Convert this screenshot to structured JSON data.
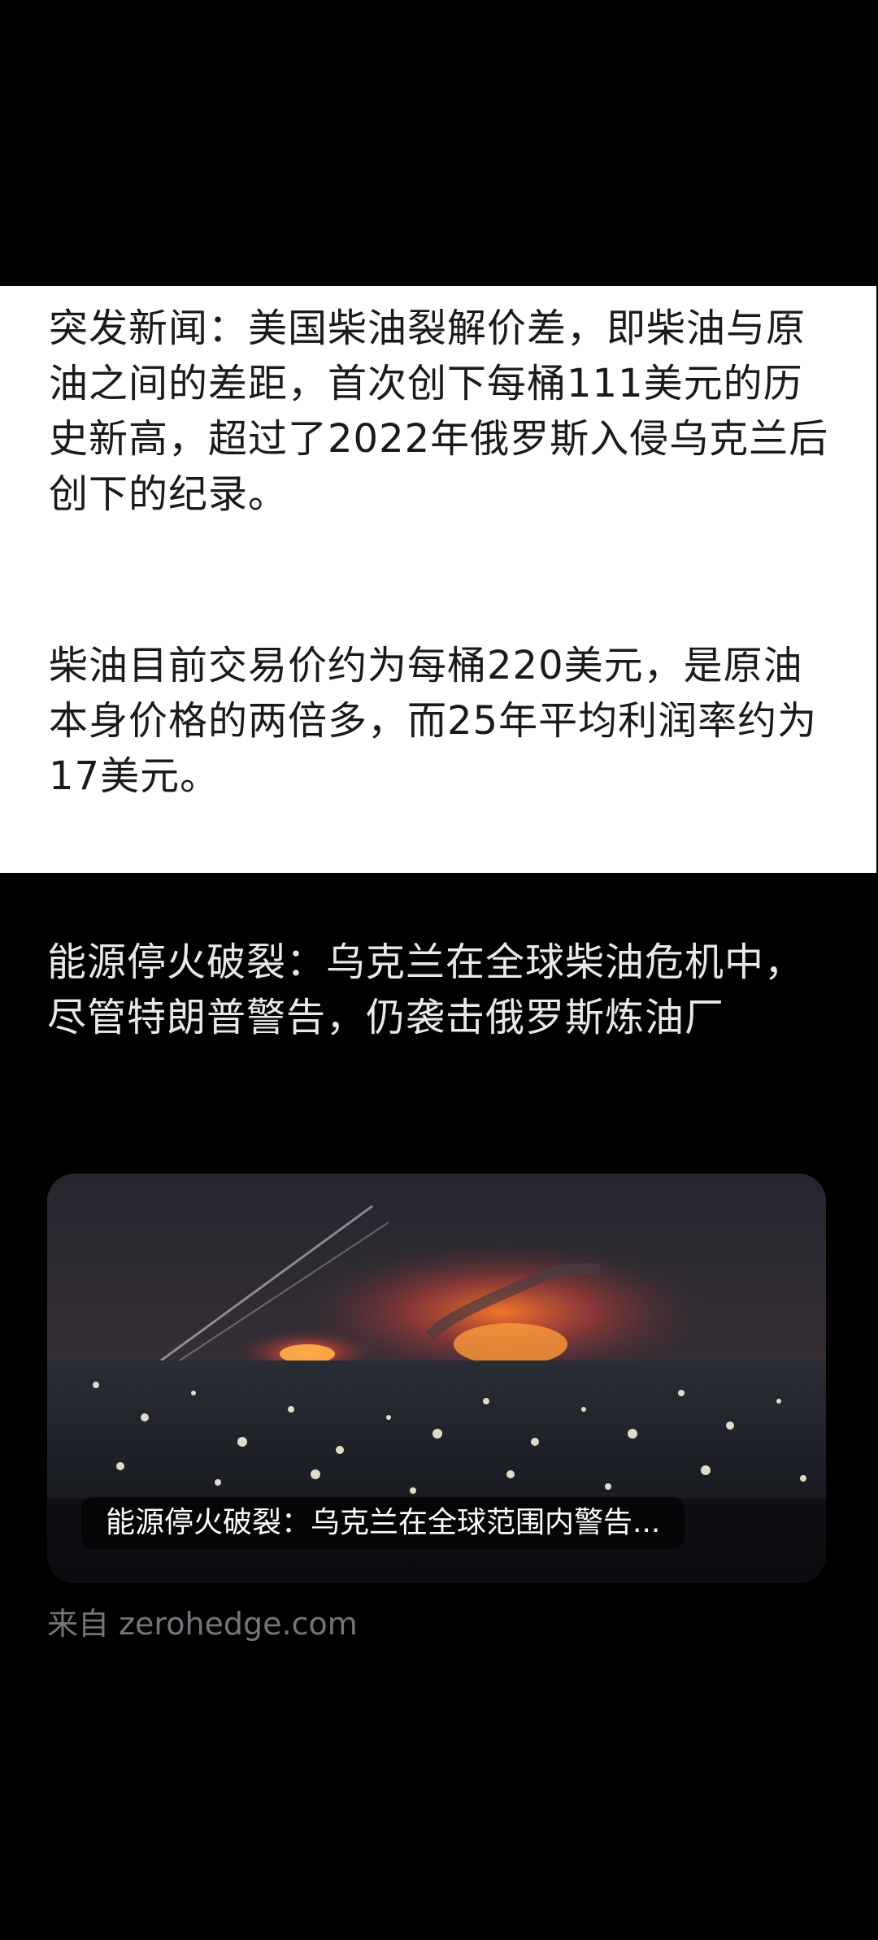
{
  "post": {
    "paragraph_1": "突发新闻：美国柴油裂解价差，即柴油与原油之间的差距，首次创下每桶111美元的历史新高，超过了2022年俄罗斯入侵乌克兰后创下的纪录。",
    "paragraph_2": "柴油目前交易价约为每桶220美元，是原油本身价格的两倍多，而25年平均利润率约为17美元。"
  },
  "link_card": {
    "headline": "能源停火破裂：乌克兰在全球柴油危机中，尽管特朗普警告，仍袭击俄罗斯炼油厂",
    "image_caption": "能源停火破裂：乌克兰在全球范围内警告...",
    "source": "来自 zerohedge.com"
  },
  "colors": {
    "post_background": "#ffffff",
    "post_text": "#1a1a1a",
    "card_background": "#000000",
    "card_text": "#e7e9ea",
    "source_text": "#71767b"
  }
}
